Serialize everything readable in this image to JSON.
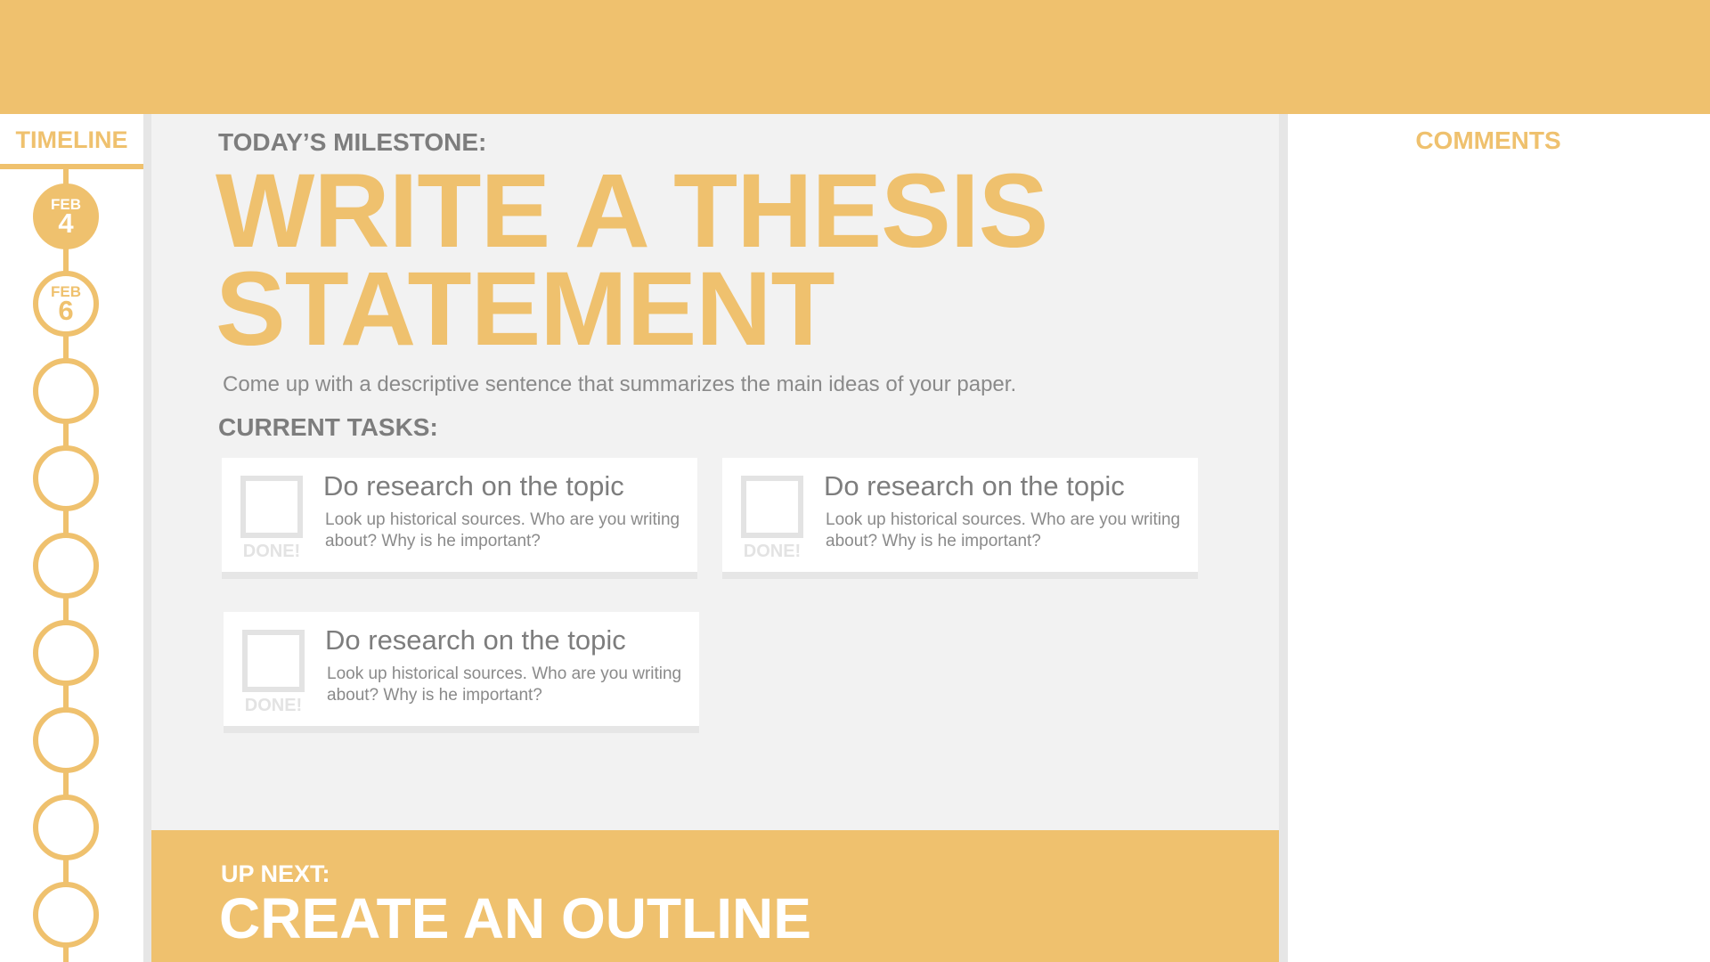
{
  "colors": {
    "accent": "#efc16e",
    "panel_bg": "#f2f2f2",
    "gutter": "#e6e6e6",
    "text_gray": "#7d7d7d",
    "check_gray": "#e3e3e3"
  },
  "timeline": {
    "title": "TIMELINE",
    "nodes": [
      {
        "month": "FEB",
        "day": "4",
        "state": "filled"
      },
      {
        "month": "FEB",
        "day": "6",
        "state": "outlined"
      },
      {
        "month": "",
        "day": "",
        "state": "empty"
      },
      {
        "month": "",
        "day": "",
        "state": "empty"
      },
      {
        "month": "",
        "day": "",
        "state": "empty"
      },
      {
        "month": "",
        "day": "",
        "state": "empty"
      },
      {
        "month": "",
        "day": "",
        "state": "empty"
      },
      {
        "month": "",
        "day": "",
        "state": "empty"
      },
      {
        "month": "",
        "day": "",
        "state": "empty"
      }
    ]
  },
  "milestone": {
    "label": "TODAY’S MILESTONE:",
    "title_line1": "WRITE A THESIS",
    "title_line2": "STATEMENT",
    "description": "Come up with a descriptive sentence that summarizes the main ideas of your paper."
  },
  "tasks": {
    "label": "CURRENT TASKS:",
    "items": [
      {
        "title": "Do research on the topic",
        "description": "Look up historical sources. Who are you writing about? Why is he important?",
        "done_label": "DONE!",
        "checked": false
      },
      {
        "title": "Do research on the topic",
        "description": "Look up historical sources. Who are you writing about? Why is he important?",
        "done_label": "DONE!",
        "checked": false
      },
      {
        "title": "Do research on the topic",
        "description": "Look up historical sources. Who are you writing about? Why is he important?",
        "done_label": "DONE!",
        "checked": false
      }
    ]
  },
  "up_next": {
    "label": "UP NEXT:",
    "title": "CREATE AN OUTLINE"
  },
  "comments": {
    "title": "COMMENTS"
  }
}
